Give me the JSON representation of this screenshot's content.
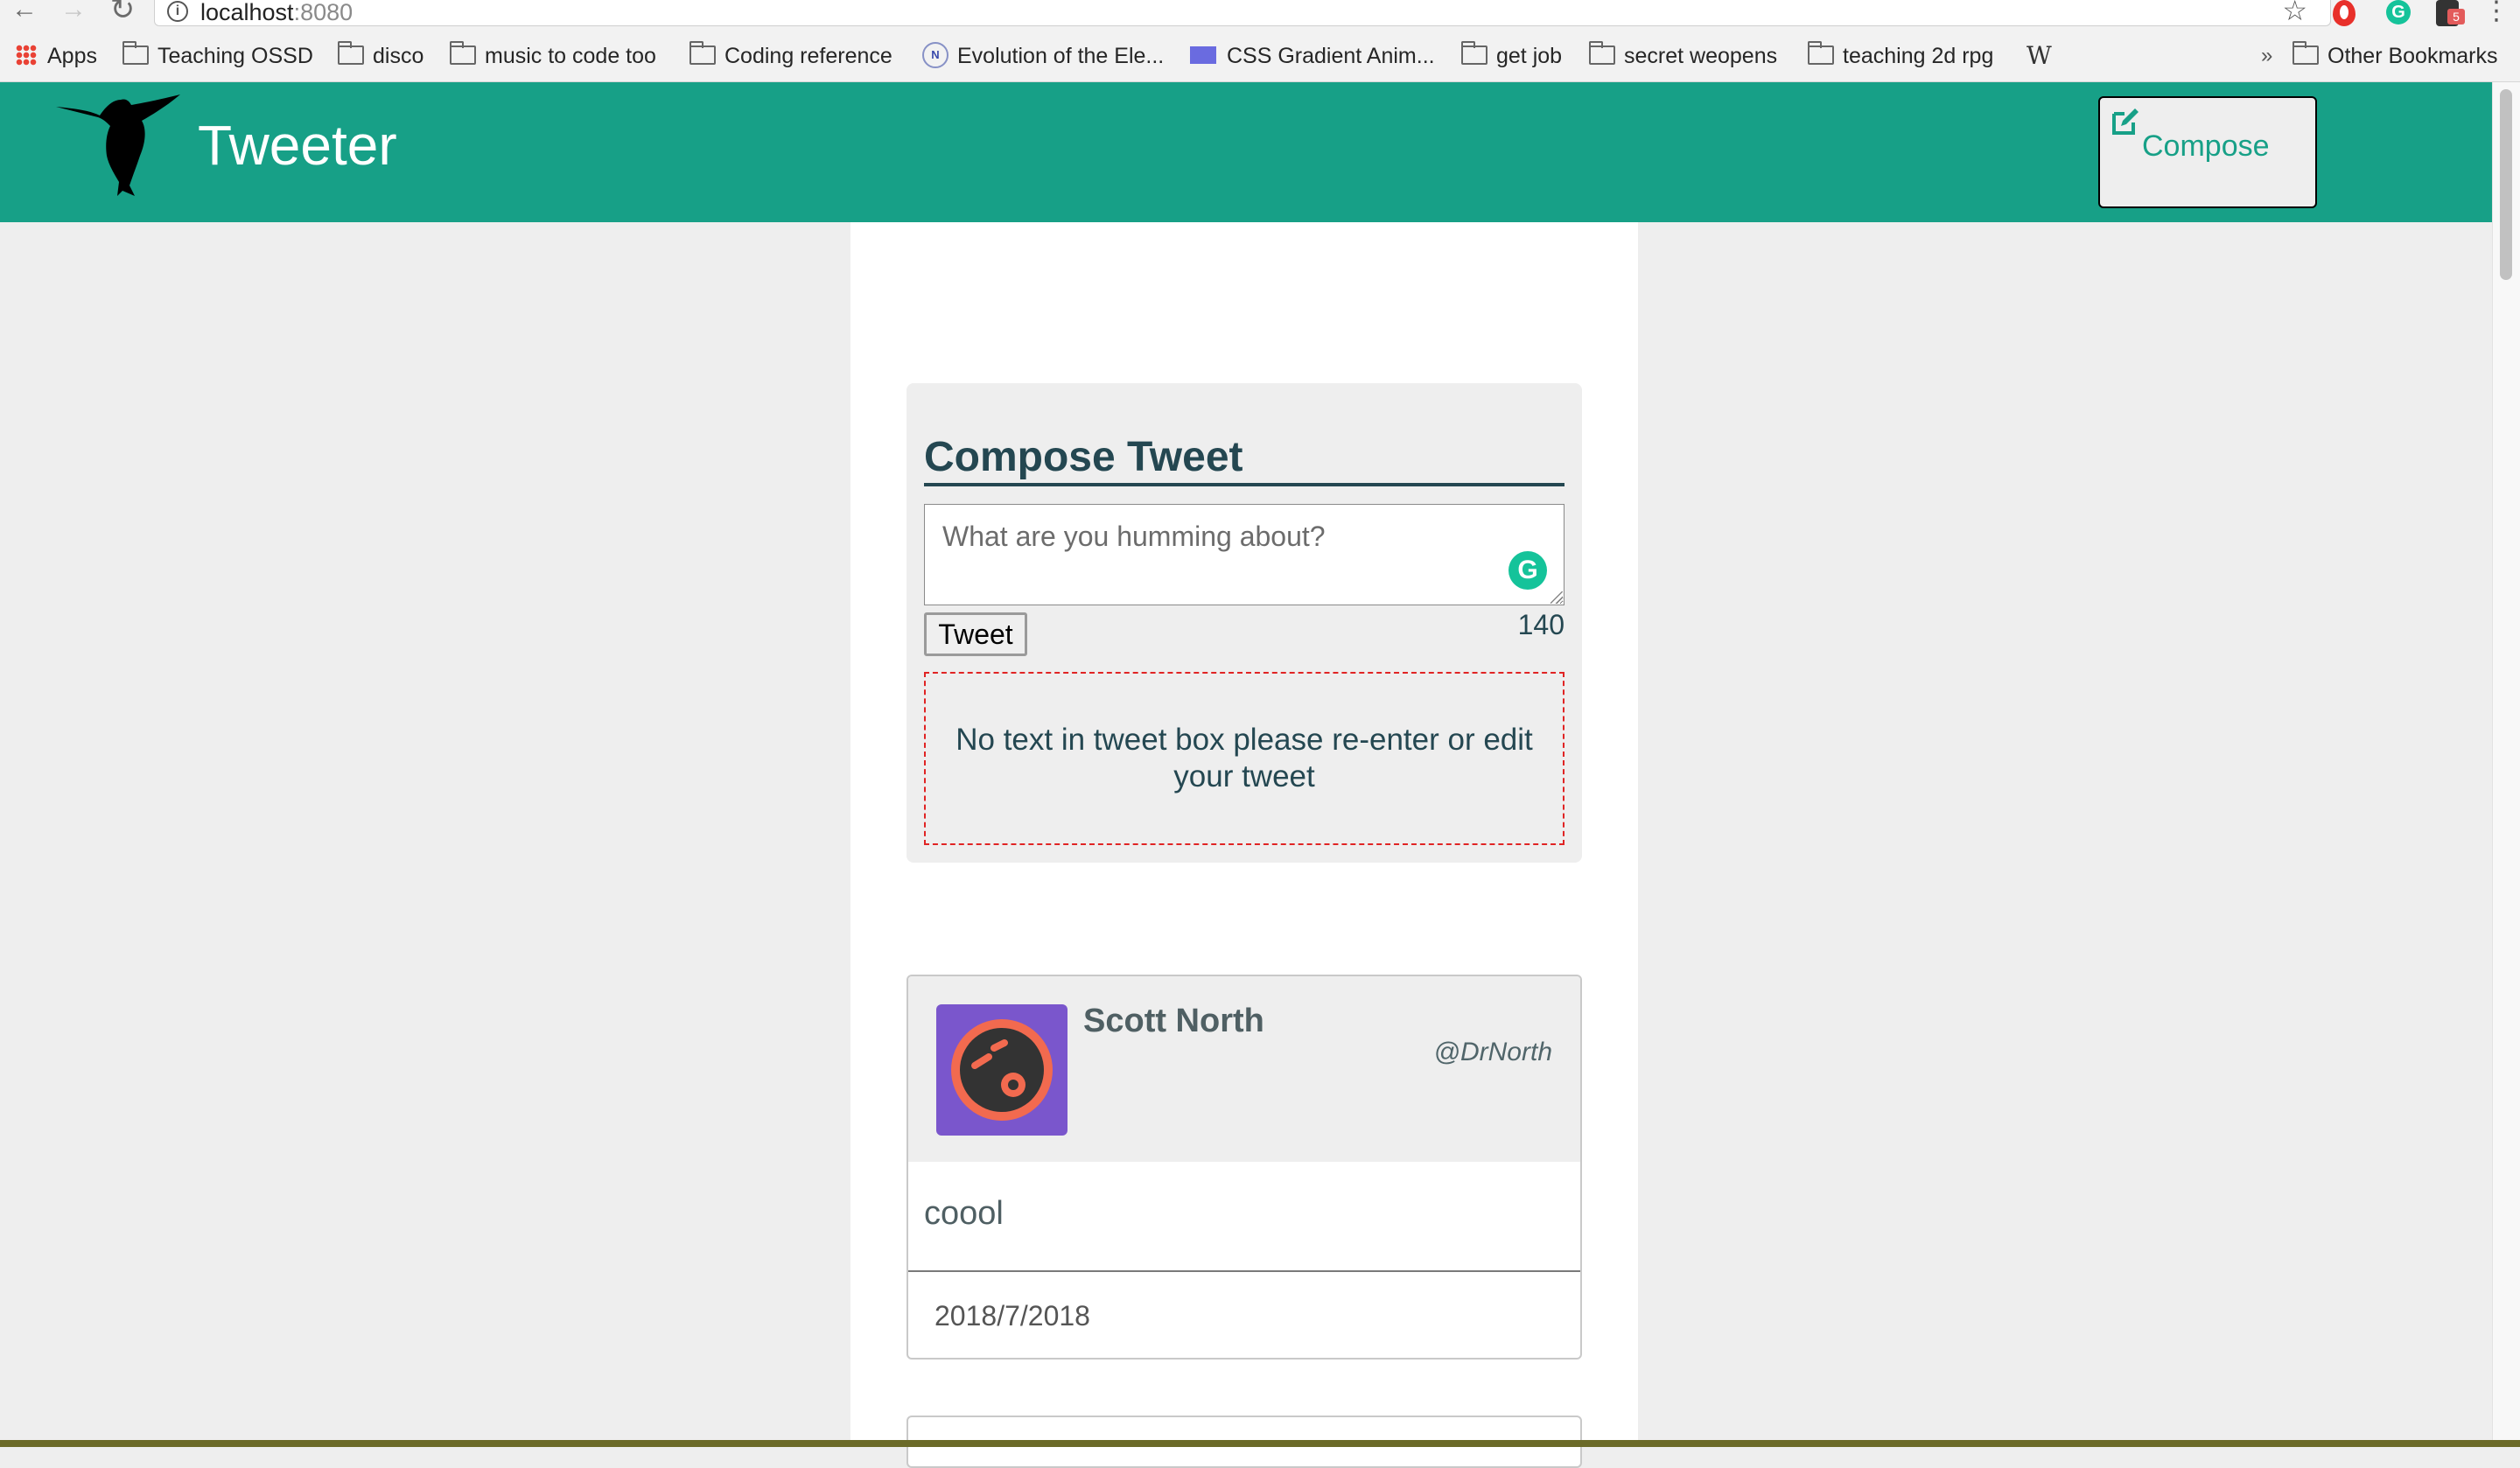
{
  "browser": {
    "url_host": "localhost",
    "url_port": ":8080",
    "bookmarks": [
      {
        "label": "Apps",
        "icon": "apps-grid-icon"
      },
      {
        "label": "Teaching OSSD",
        "icon": "folder-icon"
      },
      {
        "label": "disco",
        "icon": "folder-icon"
      },
      {
        "label": "music to code too",
        "icon": "folder-icon"
      },
      {
        "label": "Coding reference",
        "icon": "folder-icon"
      },
      {
        "label": "Evolution of the Ele...",
        "icon": "site-icon"
      },
      {
        "label": "CSS Gradient Anim...",
        "icon": "site-icon"
      },
      {
        "label": "get job",
        "icon": "folder-icon"
      },
      {
        "label": "secret weopens",
        "icon": "folder-icon"
      },
      {
        "label": "teaching 2d rpg",
        "icon": "folder-icon"
      },
      {
        "label": "W",
        "icon": "wikipedia-icon"
      }
    ],
    "other_bookmarks": "Other Bookmarks",
    "more_chevron": "»",
    "extension_badge": "5"
  },
  "header": {
    "title": "Tweeter",
    "compose_label": "Compose"
  },
  "compose": {
    "heading": "Compose Tweet",
    "placeholder": "What are you humming about?",
    "button_label": "Tweet",
    "counter": "140",
    "error_message": "No text in tweet box please re-enter or edit your tweet"
  },
  "tweets": [
    {
      "name": "Scott North",
      "handle": "@DrNorth",
      "content": "coool",
      "date": "2018/7/2018"
    }
  ],
  "colors": {
    "brand": "#17a087",
    "text": "#244751",
    "error_border": "#e02424",
    "avatar_bg": "#7a56cc",
    "avatar_face": "#f26a4f"
  }
}
